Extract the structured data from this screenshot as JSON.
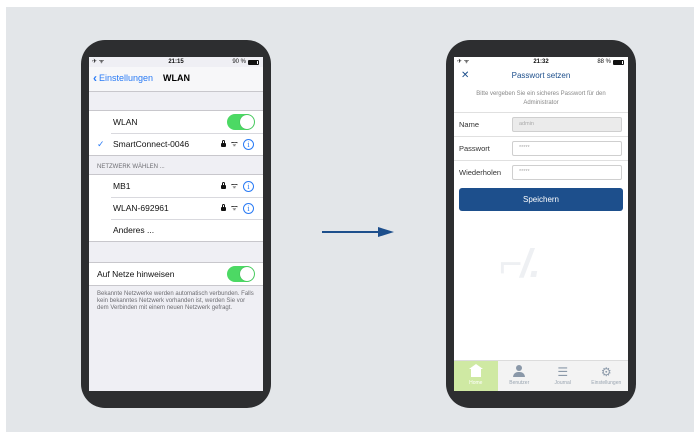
{
  "left_phone": {
    "status": {
      "time": "21:15",
      "battery": "90 %"
    },
    "nav": {
      "back_label": "Einstellungen",
      "title": "WLAN"
    },
    "wlan_row": {
      "label": "WLAN",
      "toggle_on": true
    },
    "connected_network": {
      "name": "SmartConnect-0046"
    },
    "section_header": "NETZWERK WÄHLEN ...",
    "networks": [
      {
        "name": "MB1"
      },
      {
        "name": "WLAN-692961"
      }
    ],
    "other_label": "Anderes ...",
    "ask_row": {
      "label": "Auf Netze hinweisen",
      "toggle_on": true
    },
    "footer_text": "Bekannte Netzwerke werden automatisch verbunden. Falls kein bekanntes Netzwerk vorhanden ist, werden Sie vor dem Verbinden mit einem neuen Netzwerk gefragt."
  },
  "right_phone": {
    "status": {
      "time": "21:32",
      "battery": "88 %"
    },
    "nav": {
      "title": "Passwort setzen"
    },
    "hint": "Bitte vergeben Sie ein sicheres Passwort für den Administrator",
    "form": {
      "name_label": "Name",
      "name_value": "admin",
      "password_label": "Passwort",
      "password_value": "*****",
      "repeat_label": "Wiederholen",
      "repeat_value": "*****"
    },
    "save_label": "Speichern",
    "tabs": [
      {
        "label": "Home",
        "icon": "home-icon"
      },
      {
        "label": "Benutzer",
        "icon": "user-icon"
      },
      {
        "label": "Journal",
        "icon": "list-icon"
      },
      {
        "label": "Einstellungen",
        "icon": "gear-icon"
      }
    ]
  },
  "colors": {
    "ios_blue": "#2a7bf5",
    "toggle_green": "#4cd964",
    "brand_blue": "#1d4f8c",
    "arrow": "#1d4f8c"
  }
}
